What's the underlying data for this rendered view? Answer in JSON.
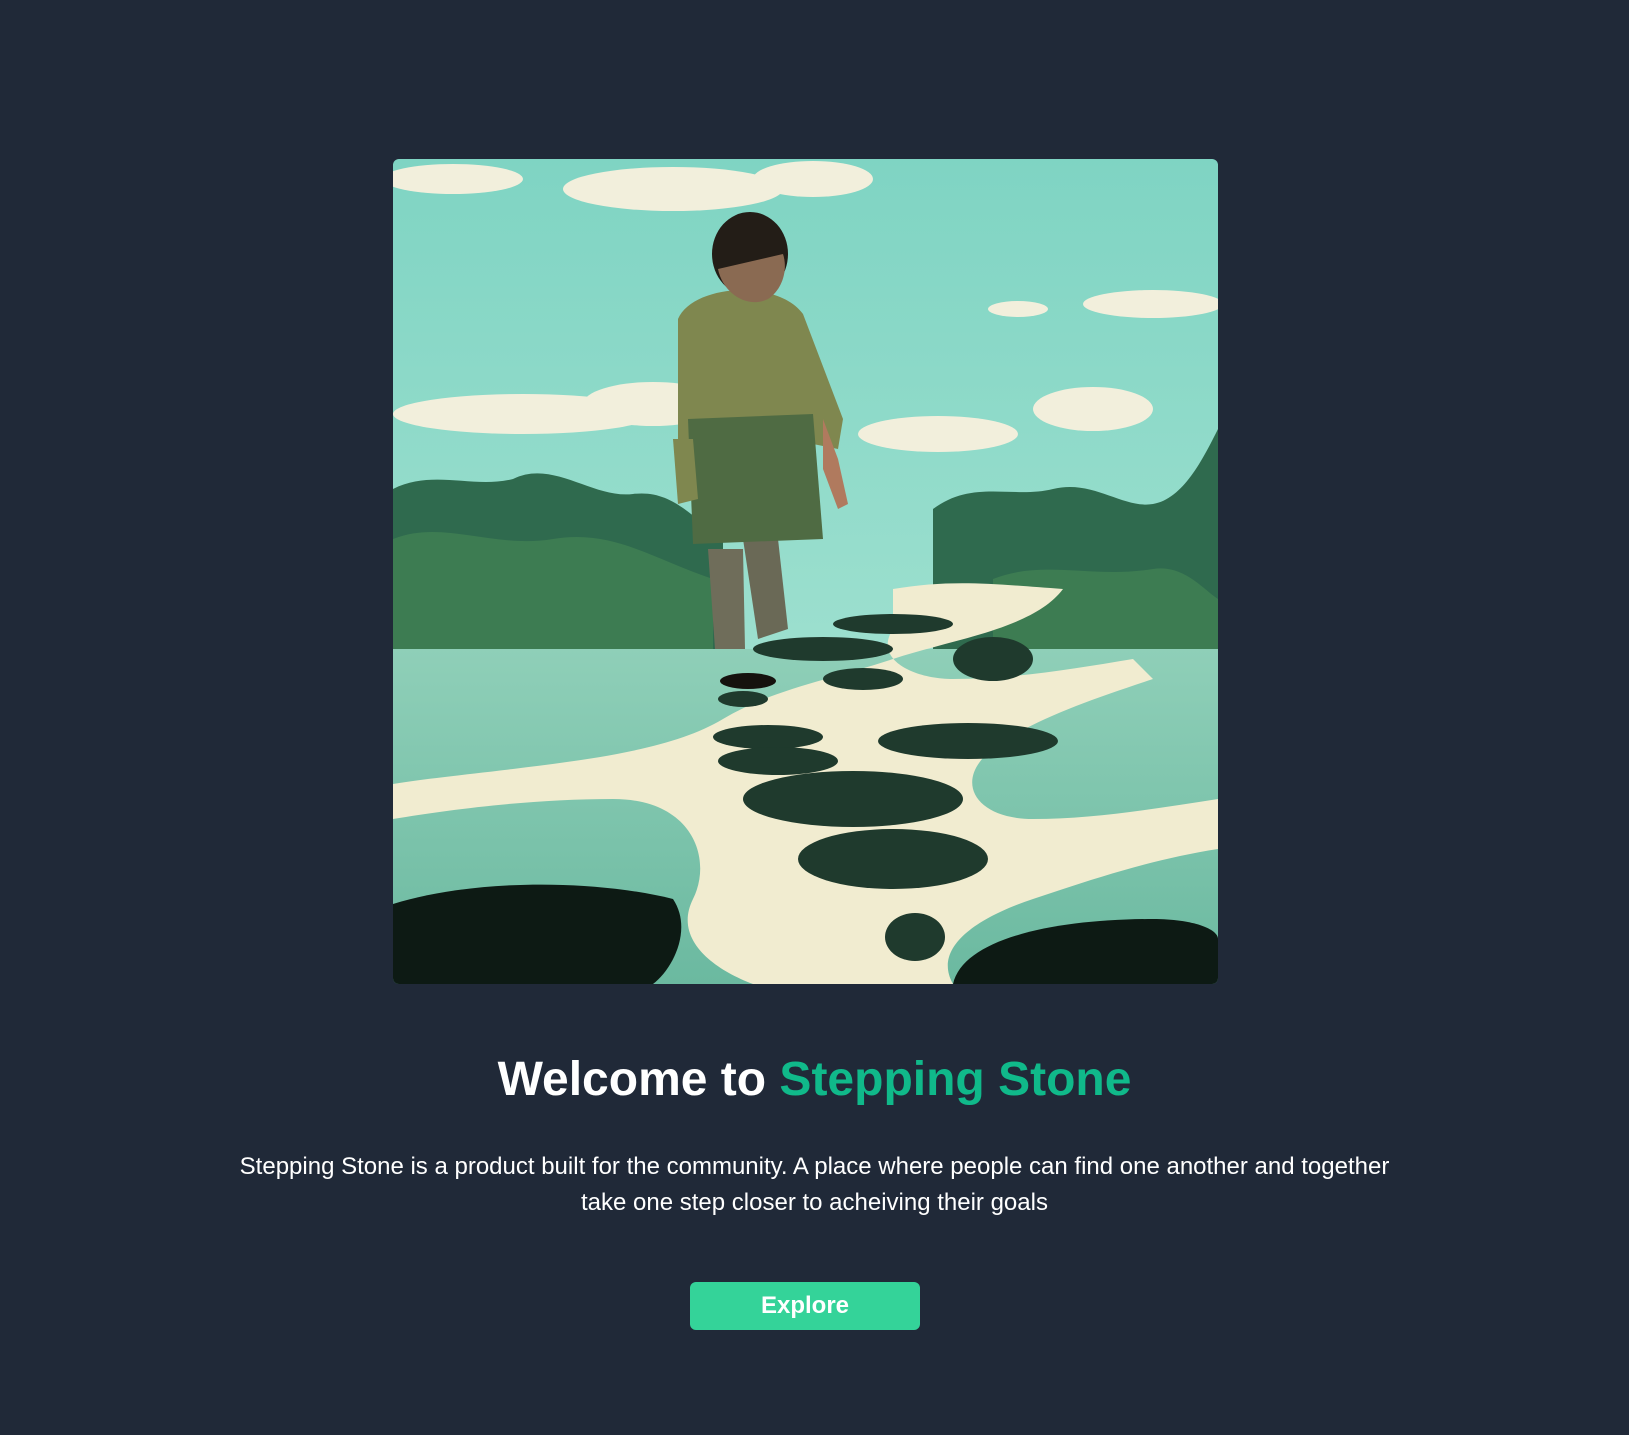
{
  "hero": {
    "image_alt": "Illustration of a person walking across stepping stones over a river"
  },
  "headline": {
    "prefix": "Welcome to ",
    "brand": "Stepping Stone"
  },
  "description": "Stepping Stone is a product built for the community. A place where people can find one another and together take one step closer to acheiving their goals",
  "cta": {
    "label": "Explore"
  },
  "colors": {
    "background": "#202938",
    "accent": "#10b98a",
    "button": "#34d399"
  }
}
